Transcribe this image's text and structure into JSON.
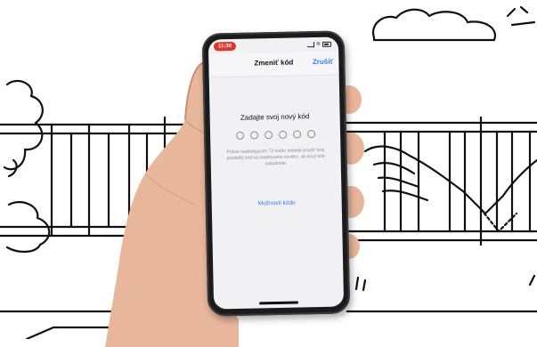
{
  "status_bar": {
    "time": "11:30"
  },
  "nav": {
    "title": "Zmeniť kód",
    "cancel": "Zrušiť"
  },
  "content": {
    "prompt": "Zadajte svoj nový kód",
    "code_length": 6,
    "info": "Počas nasledujúcich 72 hodín môžete použiť svoj predošlý kód na resetovanie nového, ak nový kód zabudnete.",
    "options_link": "Možnosti kódu"
  },
  "colors": {
    "accent": "#2f7cf6",
    "recording_pill": "#e0342a",
    "screen_bg": "#f1f1f4"
  }
}
